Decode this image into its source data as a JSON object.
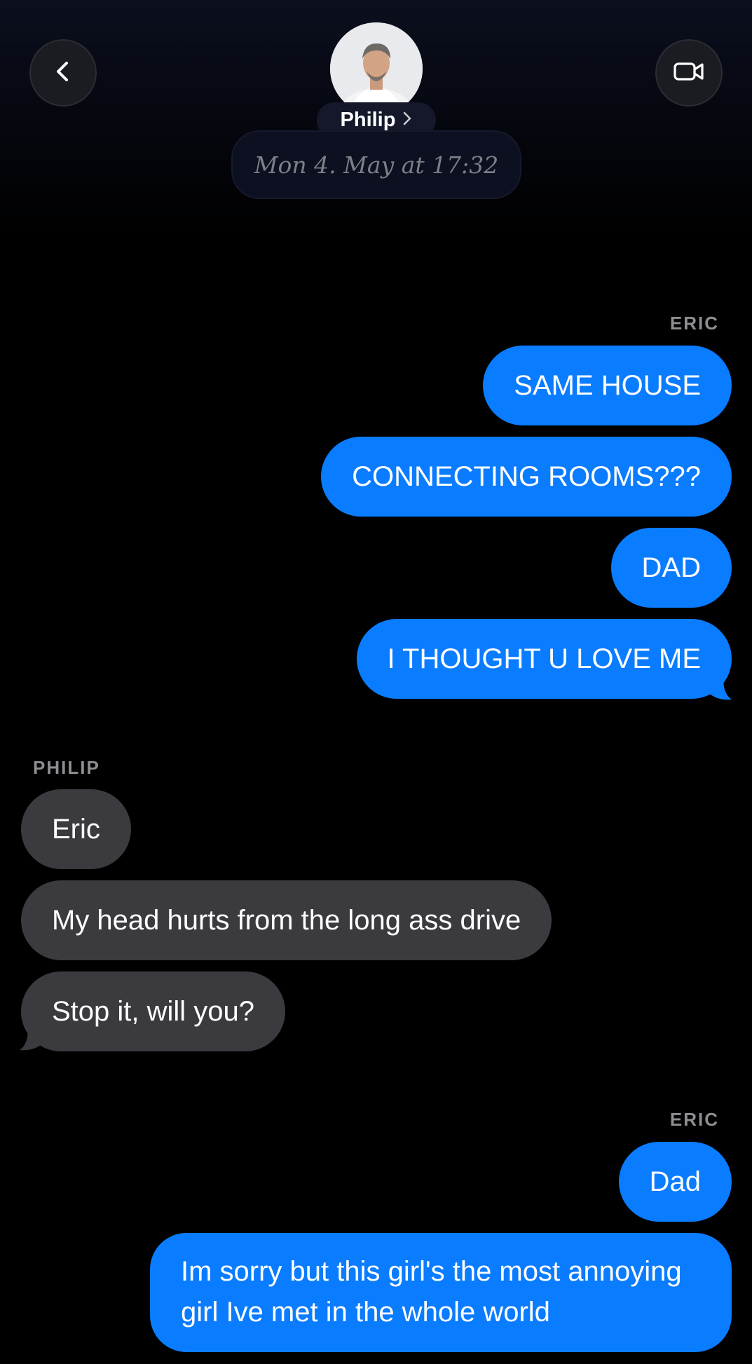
{
  "header": {
    "contact_name": "Philip",
    "back_icon": "chevron-left-icon",
    "video_icon": "video-camera-icon",
    "name_chevron_icon": "chevron-right-icon",
    "date": "Mon 4. May at 17:32"
  },
  "colors": {
    "outgoing_bubble": "#0a7cff",
    "incoming_bubble": "#3b3b3f",
    "background": "#000000",
    "sender_label": "#8e8e93"
  },
  "conversation": {
    "groups": [
      {
        "sender": "ERIC",
        "direction": "outgoing",
        "messages": [
          "SAME HOUSE",
          "CONNECTING ROOMS???",
          "DAD",
          "I THOUGHT U LOVE ME"
        ]
      },
      {
        "sender": "PHILIP",
        "direction": "incoming",
        "messages": [
          "Eric",
          "My head hurts from the long ass drive",
          "Stop it, will you?"
        ]
      },
      {
        "sender": "ERIC",
        "direction": "outgoing",
        "messages": [
          "Dad",
          "Im sorry but this girl's the most annoying girl Ive met in the whole world"
        ]
      }
    ]
  }
}
